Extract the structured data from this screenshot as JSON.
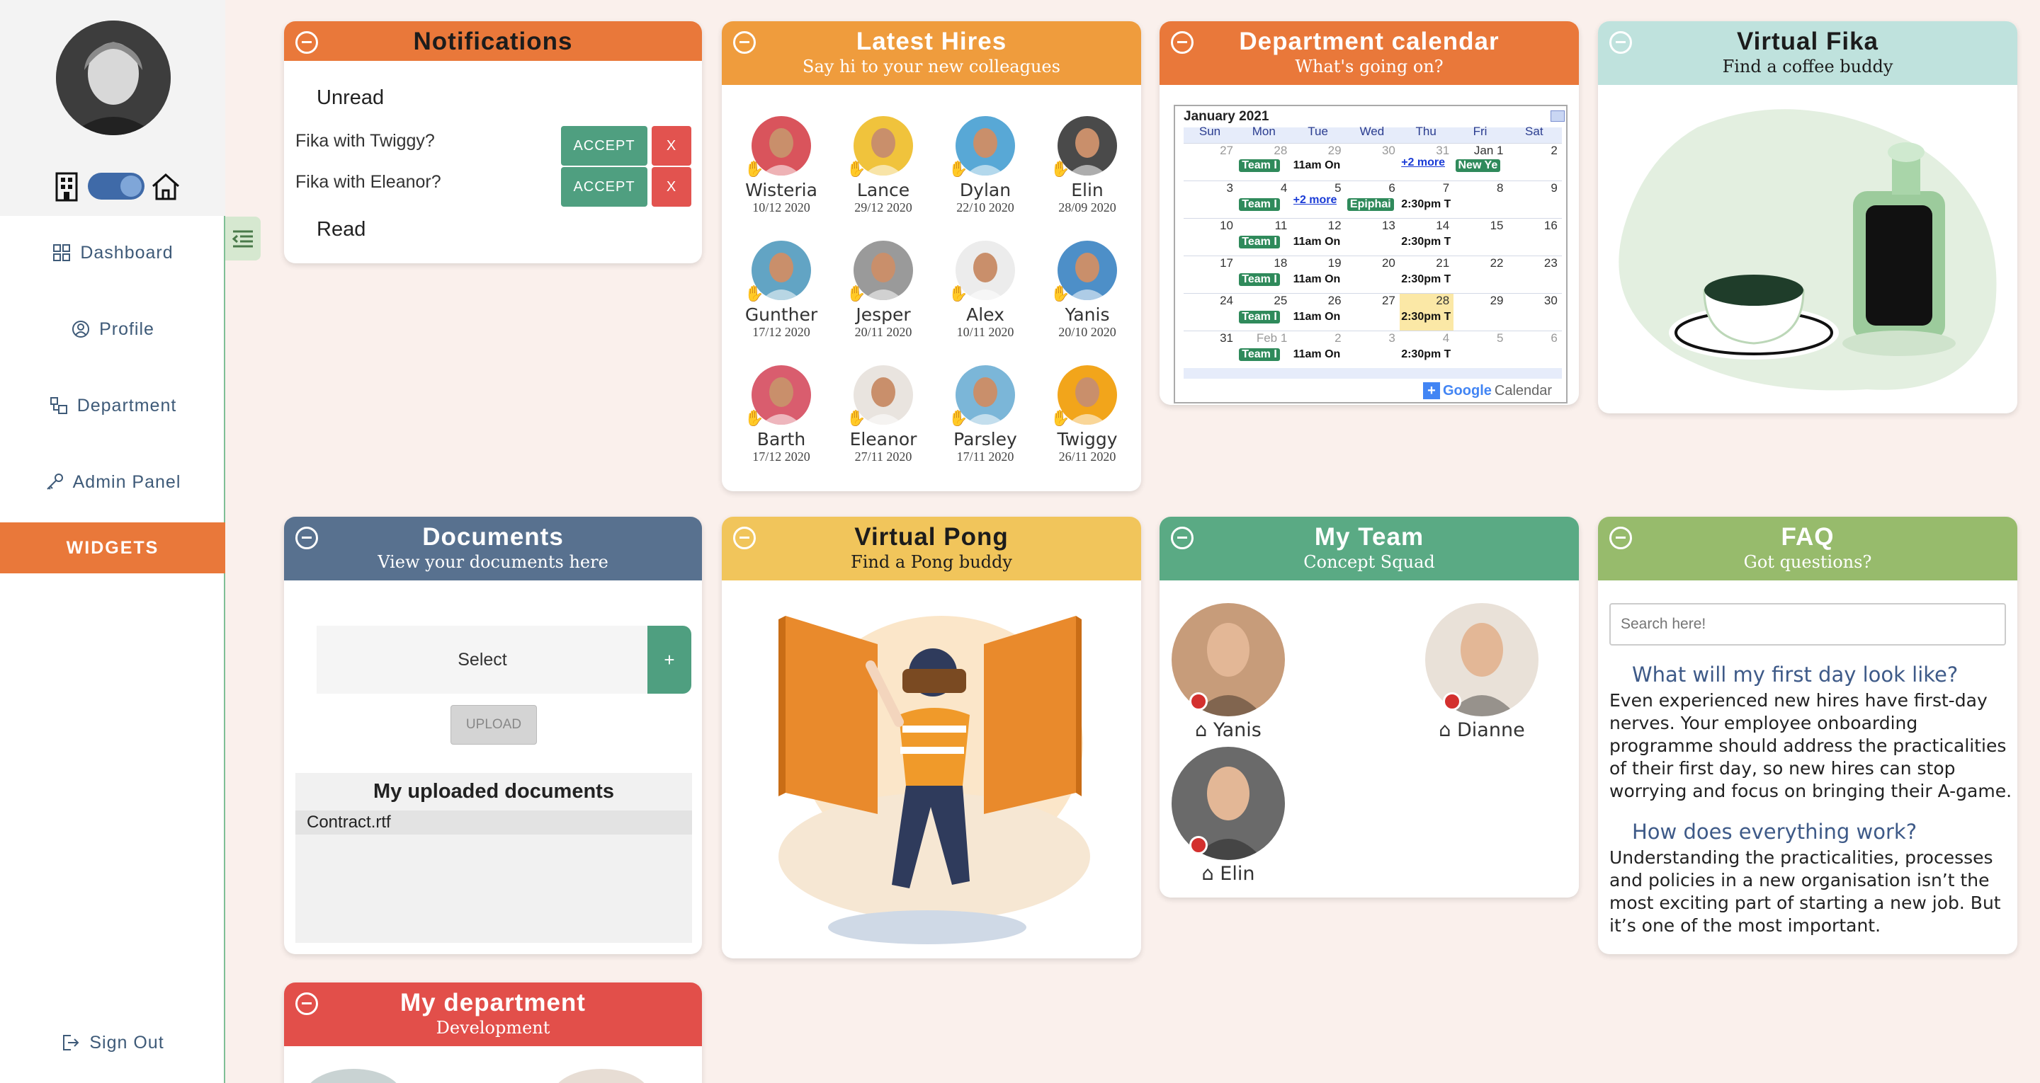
{
  "sidebar": {
    "nav": [
      {
        "label": "Dashboard",
        "icon": "dashboard-icon"
      },
      {
        "label": "Profile",
        "icon": "profile-icon"
      },
      {
        "label": "Department",
        "icon": "department-icon"
      },
      {
        "label": "Admin Panel",
        "icon": "key-icon"
      }
    ],
    "widgets_label": "WIDGETS",
    "signout_label": "Sign Out",
    "location_toggle": {
      "left_icon": "office-building-icon",
      "right_icon": "home-icon",
      "state": "home"
    }
  },
  "colors": {
    "orange": "#e9783a",
    "amber": "#ef9c3d",
    "teal_light": "#bfe2dd",
    "slate": "#58718f",
    "yellow": "#f1c55b",
    "green": "#5aaa84",
    "olive": "#97bb6c",
    "red": "#e24f4a",
    "accept": "#4f9f80",
    "reject": "#e2534f"
  },
  "notifications": {
    "title": "Notifications",
    "unread_label": "Unread",
    "read_label": "Read",
    "items": [
      {
        "text": "Fika with Twiggy?",
        "accept": "ACCEPT",
        "reject": "X"
      },
      {
        "text": "Fika with Eleanor?",
        "accept": "ACCEPT",
        "reject": "X"
      }
    ]
  },
  "hires": {
    "title": "Latest Hires",
    "subtitle": "Say hi to your new colleagues",
    "people": [
      {
        "name": "Wisteria",
        "date": "10/12 2020",
        "bg": "#d9545c"
      },
      {
        "name": "Lance",
        "date": "29/12 2020",
        "bg": "#f0c33c"
      },
      {
        "name": "Dylan",
        "date": "22/10 2020",
        "bg": "#58a8d6"
      },
      {
        "name": "Elin",
        "date": "28/09 2020",
        "bg": "#4a4a4a"
      },
      {
        "name": "Gunther",
        "date": "17/12 2020",
        "bg": "#62a4c4"
      },
      {
        "name": "Jesper",
        "date": "20/11 2020",
        "bg": "#9a9a9a"
      },
      {
        "name": "Alex",
        "date": "10/11 2020",
        "bg": "#ececec"
      },
      {
        "name": "Yanis",
        "date": "20/10 2020",
        "bg": "#4d8fc8"
      },
      {
        "name": "Barth",
        "date": "17/12 2020",
        "bg": "#d95d6e"
      },
      {
        "name": "Eleanor",
        "date": "27/11 2020",
        "bg": "#e9e4df"
      },
      {
        "name": "Parsley",
        "date": "17/11 2020",
        "bg": "#7bb6d8"
      },
      {
        "name": "Twiggy",
        "date": "26/11 2020",
        "bg": "#f2a51b"
      }
    ]
  },
  "calendar": {
    "title": "Department calendar",
    "subtitle": "What's going on?",
    "month": "January 2021",
    "days": [
      "Sun",
      "Mon",
      "Tue",
      "Wed",
      "Thu",
      "Fri",
      "Sat"
    ],
    "weeks": [
      [
        "27",
        "28",
        "29",
        "30",
        "31",
        "Jan 1",
        "2"
      ],
      [
        "3",
        "4",
        "5",
        "6",
        "7",
        "8",
        "9"
      ],
      [
        "10",
        "11",
        "12",
        "13",
        "14",
        "15",
        "16"
      ],
      [
        "17",
        "18",
        "19",
        "20",
        "21",
        "22",
        "23"
      ],
      [
        "24",
        "25",
        "26",
        "27",
        "28",
        "29",
        "30"
      ],
      [
        "31",
        "Feb 1",
        "2",
        "3",
        "4",
        "5",
        "6"
      ]
    ],
    "events": {
      "team": "Team I",
      "on": "11am On",
      "thu": "2:30pm T",
      "more": "+2 more",
      "new_year": "New Ye",
      "epiphany": "Epiphai"
    },
    "footer_plus": "+",
    "footer_google": "Google",
    "footer_calendar": "Calendar"
  },
  "fika": {
    "title": "Virtual Fika",
    "subtitle": "Find a coffee buddy"
  },
  "documents": {
    "title": "Documents",
    "subtitle": "View your documents here",
    "select_label": "Select",
    "add_label": "+",
    "upload_label": "UPLOAD",
    "uploaded_title": "My uploaded documents",
    "files": [
      "Contract.rtf"
    ]
  },
  "pong": {
    "title": "Virtual Pong",
    "subtitle": "Find a Pong buddy"
  },
  "team": {
    "title": "My Team",
    "subtitle": "Concept Squad",
    "members": [
      {
        "name": "Yanis",
        "bg": "#c79c7a"
      },
      {
        "name": "Dianne",
        "bg": "#e9e1d8"
      },
      {
        "name": "Elin",
        "bg": "#6a6a6a"
      }
    ]
  },
  "faq": {
    "title": "FAQ",
    "subtitle": "Got questions?",
    "search_placeholder": "Search here!",
    "items": [
      {
        "q": "What will my first day look like?",
        "a": "Even experienced new hires have first-day nerves. Your employee onboarding programme should address the practicalities of their first day, so new hires can stop worrying and focus on bringing their A-game."
      },
      {
        "q": "How does everything work?",
        "a": "Understanding the practicalities, processes and policies in a new organisation isn’t the most exciting part of starting a new job. But it’s one of the most important."
      }
    ]
  },
  "department": {
    "title": "My department",
    "subtitle": "Development"
  }
}
